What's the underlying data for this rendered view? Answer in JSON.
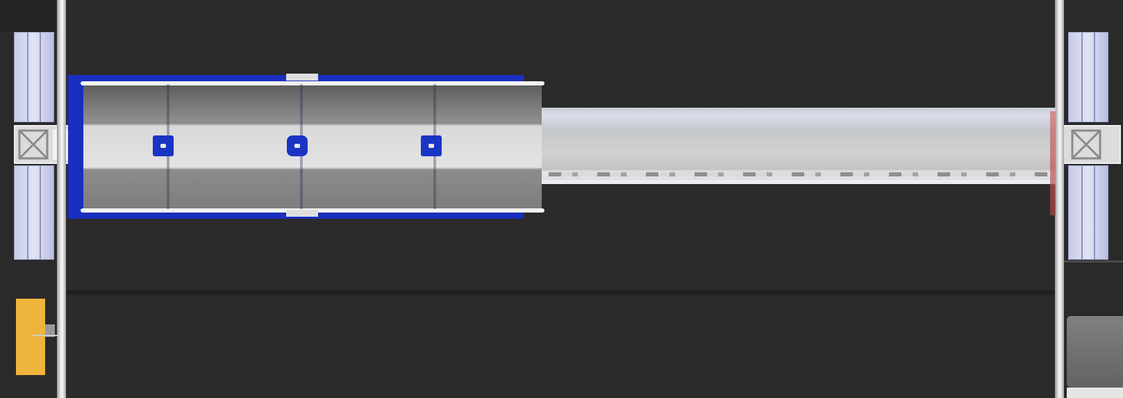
{
  "scene": {
    "description_free": true,
    "components": {
      "left_uprights": 2,
      "right_uprights": 2,
      "carriage_pads": 3
    },
    "colors": {
      "background": "#2b2b2b",
      "carriage_frame": "#1a2fc0",
      "pad": "#1a34c4",
      "yellow_device": "#efb43c",
      "boom": "#d2d2d2",
      "rail": "#e8e8e8"
    },
    "icons": {
      "left_bracket": "truss-bracket-icon",
      "right_bracket": "truss-bracket-icon"
    }
  }
}
